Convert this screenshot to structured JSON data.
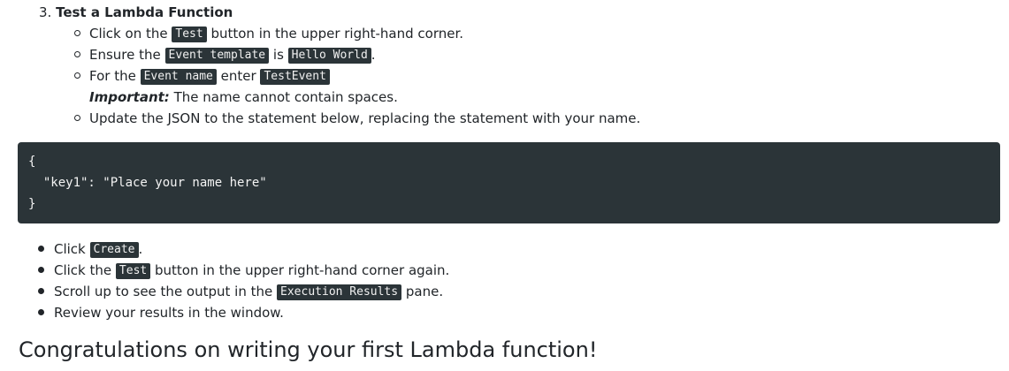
{
  "step": {
    "number": "3.",
    "title": "Test a Lambda Function"
  },
  "sub": {
    "click_pre": "Click on the",
    "test_btn": "Test",
    "click_post": "button in the upper right-hand corner.",
    "ensure_pre": "Ensure the",
    "event_template": "Event template",
    "ensure_is": "is",
    "hello_world": "Hello World",
    "ensure_post": ".",
    "for_pre": "For the",
    "event_name": "Event name",
    "for_enter": "enter",
    "test_event": "TestEvent",
    "important_label": "Important:",
    "important_text": "The name cannot contain spaces.",
    "update_text": "Update the JSON to the statement below, replacing the statement with your name."
  },
  "code_block": {
    "line1": "{",
    "line2": "  \"key1\": \"Place your name here\"",
    "line3": "}"
  },
  "list": {
    "click_pre": "Click",
    "create": "Create",
    "click_post": ".",
    "clickthe_pre": "Click the",
    "test_btn": "Test",
    "clickthe_post": "button in the upper right-hand corner again.",
    "scroll_pre": "Scroll up to see the output in the",
    "execution_results": "Execution Results",
    "scroll_post": "pane.",
    "review": "Review your results in the window."
  },
  "closing_heading": "Congratulations on writing your first Lambda function!"
}
